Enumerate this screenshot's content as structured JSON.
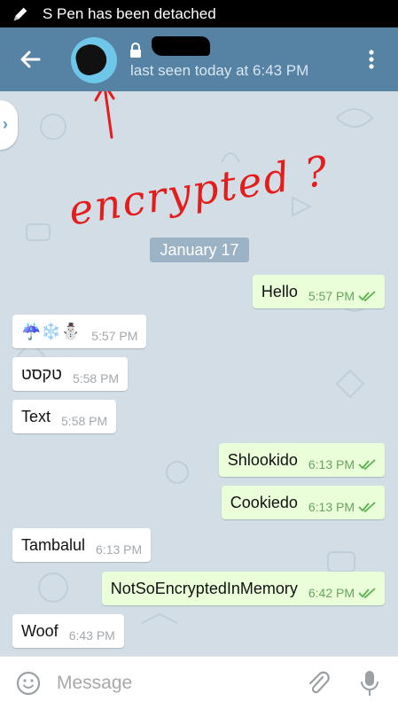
{
  "status_bar": {
    "notification": "S Pen has been detached",
    "icon": "pen-icon"
  },
  "header": {
    "back_icon": "arrow-back-icon",
    "lock_icon": "lock-icon",
    "subtitle": "last seen today at 6:43 PM",
    "menu_icon": "more-vertical-icon",
    "color": "#5682a3"
  },
  "annotation": {
    "text": "encrypted ?",
    "color": "#e41c1c"
  },
  "chat": {
    "date": "January 17",
    "messages": [
      {
        "dir": "out",
        "text": "Hello",
        "time": "5:57 PM",
        "read": true
      },
      {
        "dir": "in",
        "text": "☔❄️⛄",
        "time": "5:57 PM"
      },
      {
        "dir": "in",
        "text": "טקסט",
        "time": "5:58 PM"
      },
      {
        "dir": "in",
        "text": "Text",
        "time": "5:58 PM"
      },
      {
        "dir": "out",
        "text": "Shlookido",
        "time": "6:13 PM",
        "read": true
      },
      {
        "dir": "out",
        "text": "Cookiedo",
        "time": "6:13 PM",
        "read": true
      },
      {
        "dir": "in",
        "text": "Tambalul",
        "time": "6:13 PM"
      },
      {
        "dir": "out",
        "text": "NotSoEncryptedInMemory",
        "time": "6:42 PM",
        "read": true
      },
      {
        "dir": "in",
        "text": "Woof",
        "time": "6:43 PM"
      }
    ]
  },
  "composer": {
    "placeholder": "Message",
    "emoji_icon": "smiley-icon",
    "attach_icon": "paperclip-icon",
    "mic_icon": "microphone-icon"
  }
}
